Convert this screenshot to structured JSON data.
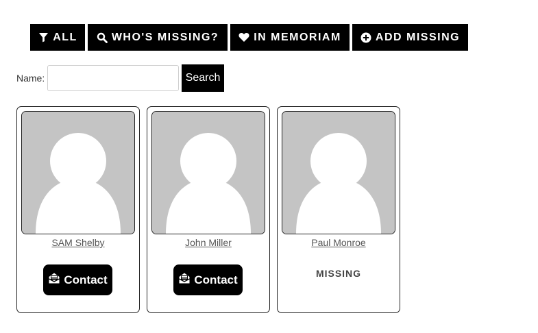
{
  "filters": {
    "all": {
      "label": "ALL",
      "icon": "filter-icon"
    },
    "missing": {
      "label": "WHO'S MISSING?",
      "icon": "search-icon"
    },
    "memoriam": {
      "label": "IN MEMORIAM",
      "icon": "heart-icon"
    },
    "add": {
      "label": "ADD MISSING",
      "icon": "plus-circle-icon"
    }
  },
  "search": {
    "label": "Name:",
    "value": "",
    "placeholder": "",
    "button_label": "Search"
  },
  "cards": [
    {
      "name": "SAM Shelby",
      "action_label": "Contact",
      "action_icon": "envelope-open-icon"
    },
    {
      "name": "John Miller",
      "action_label": "Contact",
      "action_icon": "envelope-open-icon"
    },
    {
      "name": "Paul Monroe",
      "status": "MISSING"
    }
  ],
  "colors": {
    "button_bg": "#000000",
    "button_text": "#ffffff",
    "avatar_bg": "#c4c4c4",
    "avatar_silhouette": "#ffffff"
  }
}
